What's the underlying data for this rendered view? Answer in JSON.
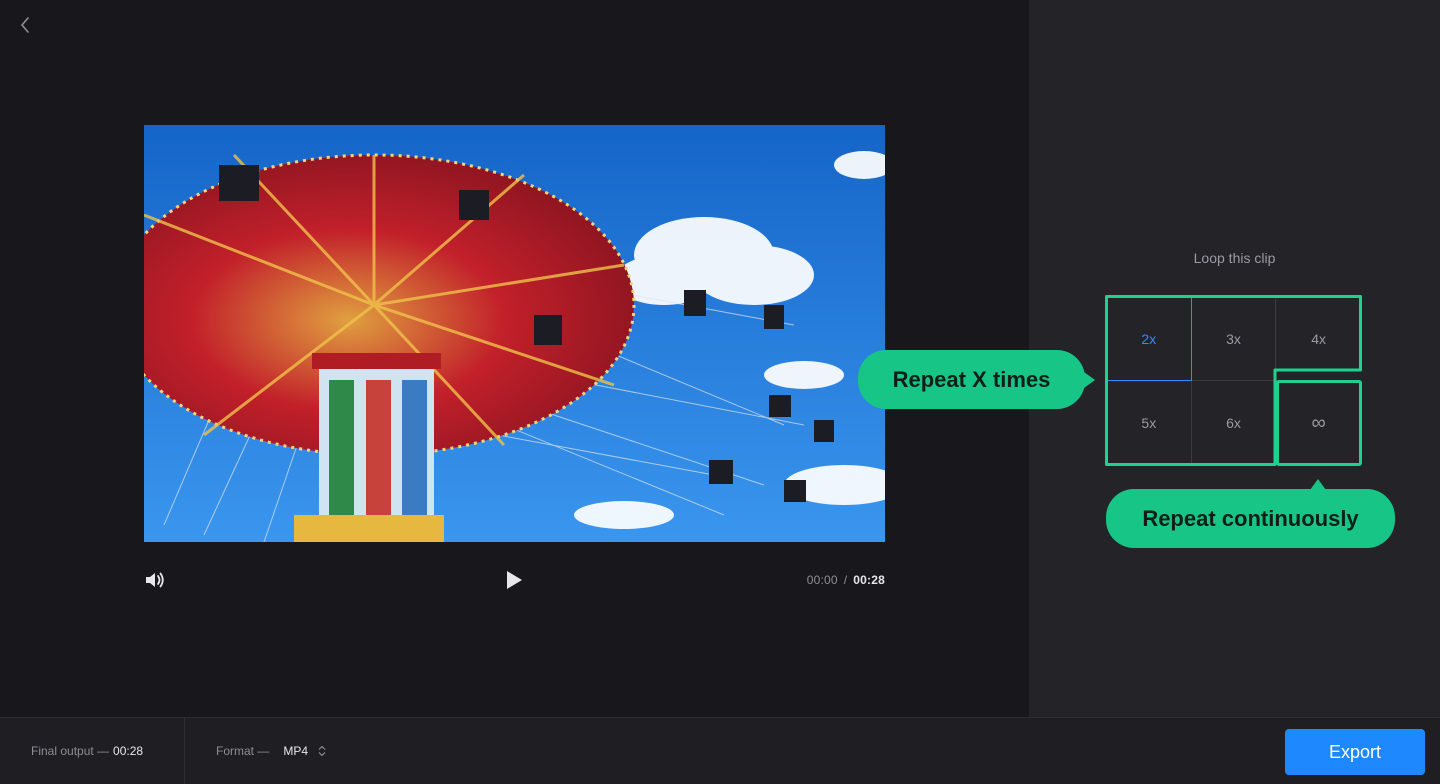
{
  "header": {
    "back_icon": "chevron-left-icon"
  },
  "player": {
    "current_time": "00:00",
    "separator": "/",
    "total_time": "00:28",
    "volume_icon": "volume-icon",
    "play_icon": "play-icon",
    "preview_image": "swing carousel ride against blue sky"
  },
  "loop_panel": {
    "title": "Loop this clip",
    "options": [
      {
        "label": "2x",
        "selected": true
      },
      {
        "label": "3x",
        "selected": false
      },
      {
        "label": "4x",
        "selected": false
      },
      {
        "label": "5x",
        "selected": false
      },
      {
        "label": "6x",
        "selected": false
      },
      {
        "label": "∞",
        "selected": false
      }
    ]
  },
  "callouts": {
    "repeat_times": "Repeat X times",
    "repeat_continuous": "Repeat continuously"
  },
  "footer": {
    "final_output_label": "Final output —",
    "final_output_value": "00:28",
    "format_label": "Format —",
    "format_value": "MP4",
    "export_label": "Export"
  },
  "colors": {
    "accent": "#1e88ff",
    "highlight": "#1fd18e",
    "callout_bg": "#17c687",
    "panel_bg": "#232328",
    "stage_bg": "#18181c"
  }
}
